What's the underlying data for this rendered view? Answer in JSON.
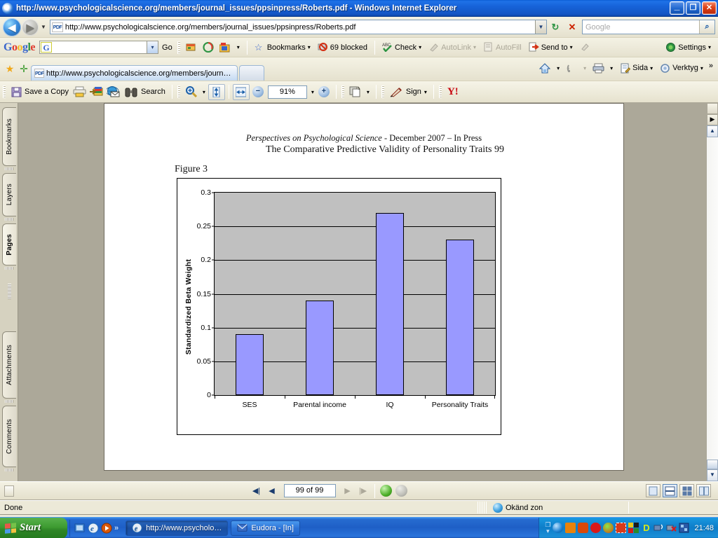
{
  "window": {
    "title": "http://www.psychologicalscience.org/members/journal_issues/ppsinpress/Roberts.pdf - Windows Internet Explorer",
    "minimize_label": "_",
    "maximize_label": "❐",
    "close_label": "✕"
  },
  "address_bar": {
    "url": "http://www.psychologicalscience.org/members/journal_issues/ppsinpress/Roberts.pdf",
    "url_icon_label": "PDF",
    "back_glyph": "◀",
    "forward_glyph": "▶",
    "dropdown_glyph": "▼",
    "refresh_glyph": "↻",
    "stop_glyph": "✕",
    "search_placeholder": "Google",
    "search_value": "",
    "search_go_glyph": "🔍"
  },
  "google_toolbar": {
    "logo": "Google",
    "search_value": "",
    "search_icon_label": "G",
    "go_label": "Go",
    "bookmarks_label": "Bookmarks",
    "blocked_label": "69 blocked",
    "check_label": "Check",
    "autolink_label": "AutoLink",
    "autofill_label": "AutoFill",
    "send_to_label": "Send to",
    "settings_label": "Settings",
    "caret": "▾"
  },
  "ie_tabs": {
    "favorites_star_glyph": "★",
    "add_favorite_glyph": "✛",
    "active_tab_label": "http://www.psychologicalscience.org/members/journ…",
    "active_tab_icon_label": "PDF",
    "new_tab_label": "",
    "home_label": "",
    "feeds_label": "",
    "print_label": "",
    "page_label": "Sida",
    "tools_label": "Verktyg",
    "overflow_glyph": "»",
    "caret": "▾"
  },
  "acrobat_toolbar": {
    "save_label": "Save a Copy",
    "print_label": "",
    "email_label": "",
    "search_label": "Search",
    "zoom_tool_label": "",
    "fit_height_label": "",
    "fit_width_label": "",
    "zoom_out_label": "−",
    "zoom_value": "91%",
    "zoom_in_label": "+",
    "snapshot_label": "",
    "sign_label": "Sign",
    "yahoo_label": "Y!",
    "caret": "▾"
  },
  "sidebar": {
    "tabs": [
      {
        "label": "Bookmarks",
        "selected": false
      },
      {
        "label": "Layers",
        "selected": false
      },
      {
        "label": "Pages",
        "selected": true
      },
      {
        "label": "Attachments",
        "selected": false
      },
      {
        "label": "Comments",
        "selected": false
      }
    ]
  },
  "document": {
    "running_head_italic": "Perspectives on Psychological Science",
    "running_head_rest": " - December 2007 – In Press",
    "title_line": "The Comparative Predictive Validity of Personality Traits 99",
    "figure_label": "Figure 3"
  },
  "chart_data": {
    "type": "bar",
    "title": "",
    "xlabel": "",
    "ylabel": "Standardized Beta Weight",
    "categories": [
      "SES",
      "Parental income",
      "IQ",
      "Personality Traits"
    ],
    "values": [
      0.09,
      0.14,
      0.27,
      0.23
    ],
    "ylim": [
      0,
      0.3
    ],
    "ytick_values": [
      0,
      0.05,
      0.1,
      0.15,
      0.2,
      0.25,
      0.3
    ],
    "ytick_labels": [
      "0",
      "0.05",
      "0.1",
      "0.15",
      "0.2",
      "0.25",
      "0.3"
    ],
    "grid": true,
    "legend": "none",
    "bar_color": "#9999FF",
    "bar_border_color": "#000000",
    "plot_background": "#C0C0C0"
  },
  "page_nav": {
    "first_glyph": "◀|",
    "prev_glyph": "◀",
    "page_value": "99 of 99",
    "next_glyph": "▶",
    "last_glyph": "|▶",
    "prev_view_glyph": "◀",
    "next_view_glyph": "▶",
    "view_single_label": "",
    "view_continuous_label": "",
    "view_facing_label": "",
    "view_continuous_facing_label": ""
  },
  "ie_status": {
    "status_text": "Done",
    "zone_text": "Okänd zon"
  },
  "taskbar": {
    "start_label": "Start",
    "quick_launch": [
      "show-desktop-icon",
      "internet-explorer-icon",
      "media-player-icon"
    ],
    "overflow_glyph": "»",
    "buttons": [
      {
        "label": "http://www.psycholo…",
        "active": true
      },
      {
        "label": "Eudora - [In]",
        "active": false
      }
    ],
    "clock": "21:48"
  }
}
